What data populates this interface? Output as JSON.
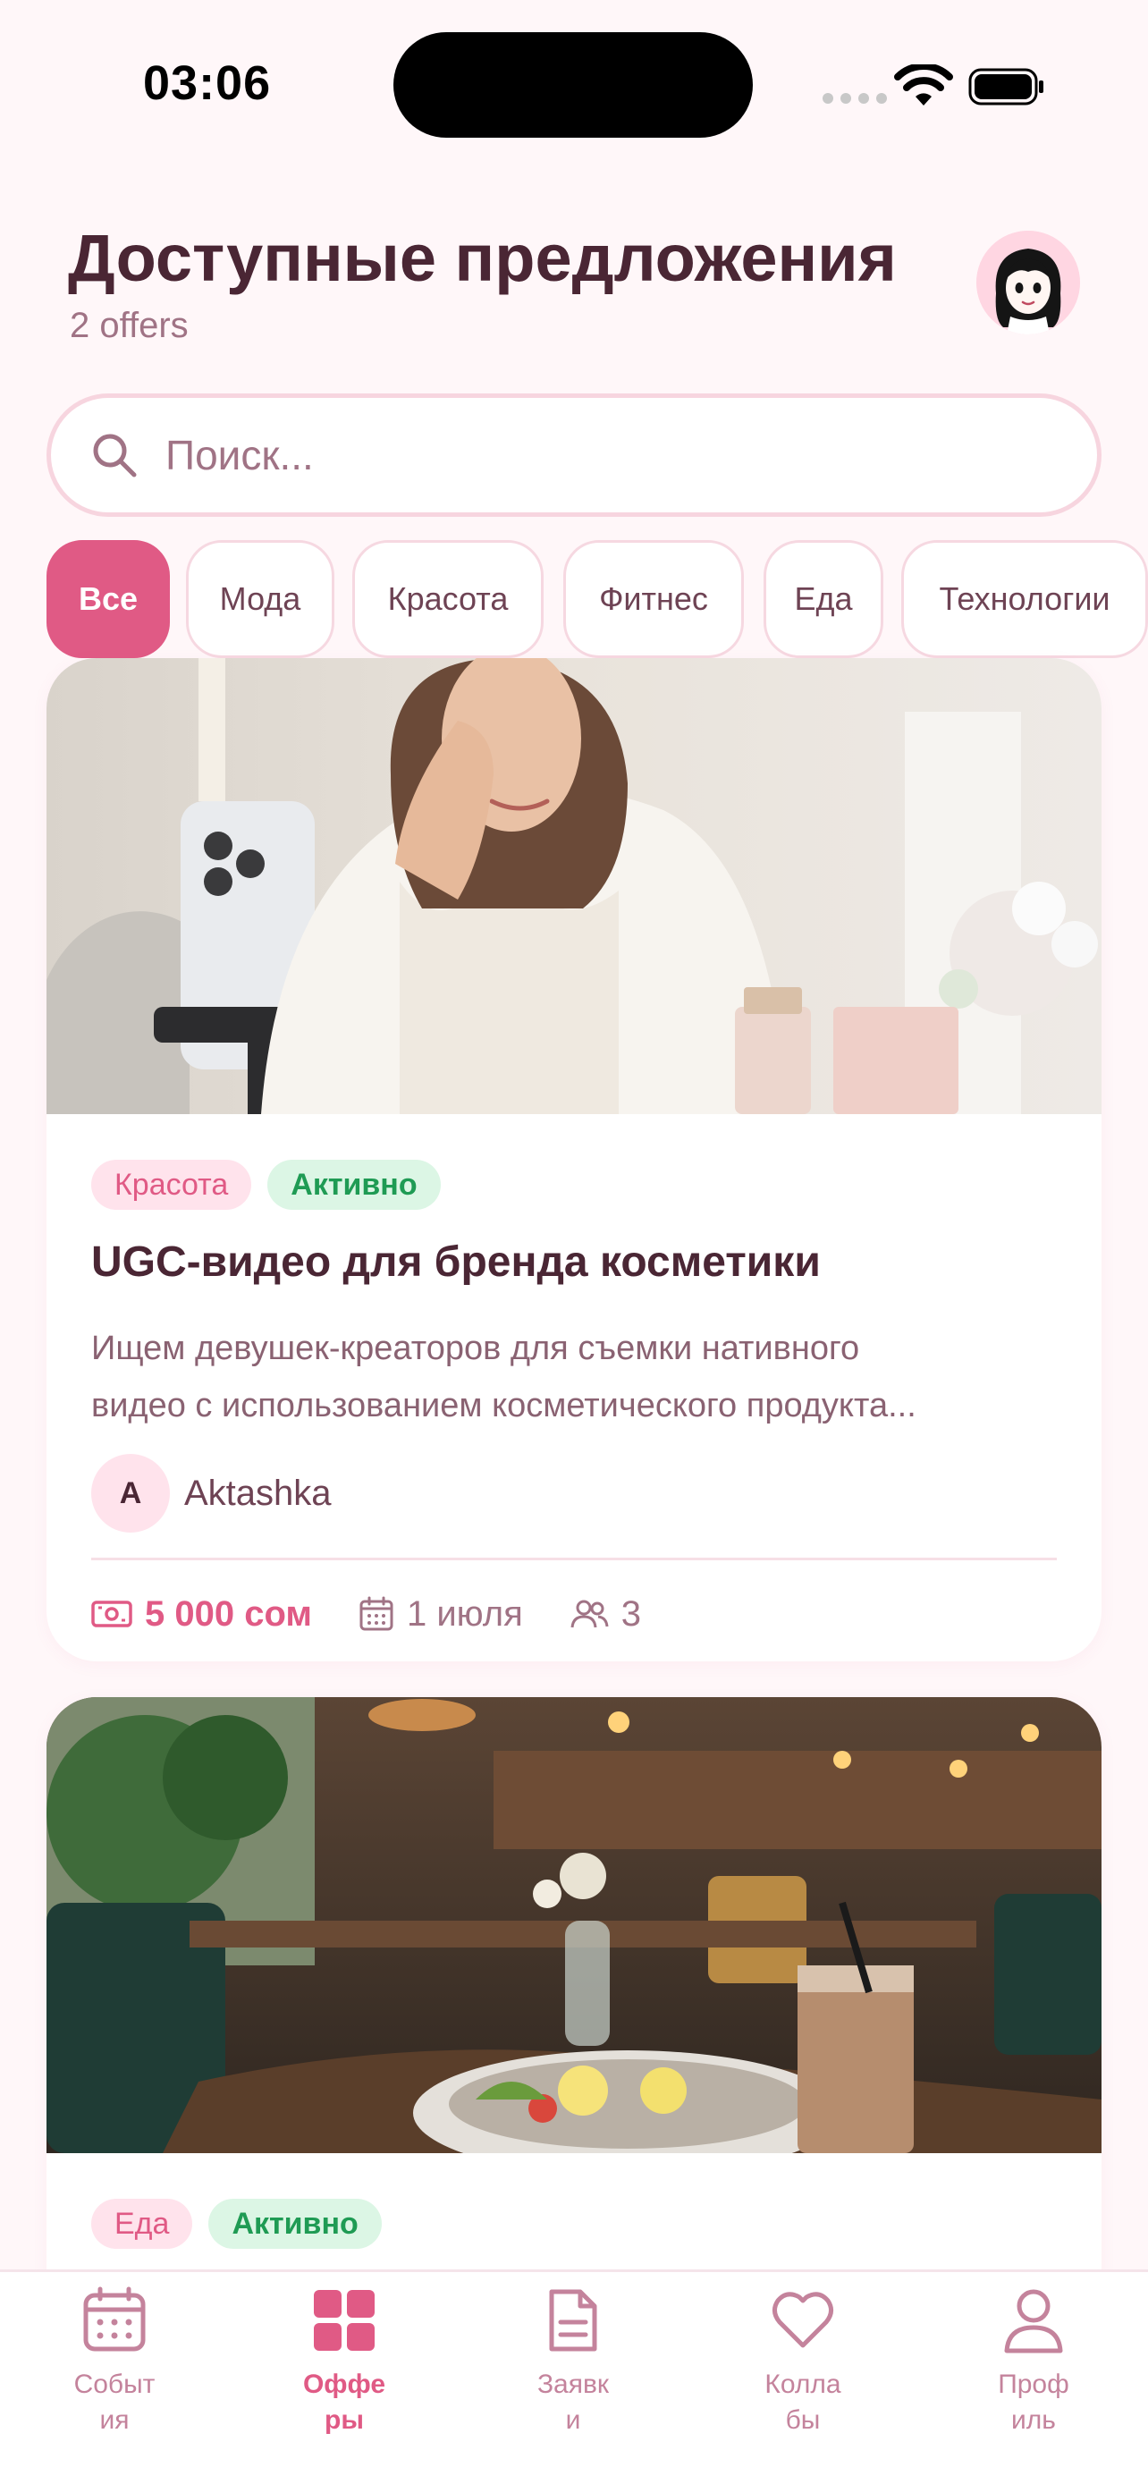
{
  "status_bar": {
    "time": "03:06"
  },
  "header": {
    "title": "Доступные предложения",
    "count": "2 offers"
  },
  "search": {
    "placeholder": "Поиск..."
  },
  "categories": [
    "Все",
    "Мода",
    "Красота",
    "Фитнес",
    "Еда",
    "Технологии"
  ],
  "active_category": "Все",
  "offers": [
    {
      "category": "Красота",
      "status": "Активно",
      "title": "UGC-видео для бренда косметики",
      "description_line1": "Ищем девушек-креаторов для съемки нативного",
      "description_line2": "видео с использованием косметического продукта...",
      "author_initial": "A",
      "author_name": "Aktashka",
      "price": "5 000 сом",
      "date": "1 июля",
      "participants": "3"
    },
    {
      "category": "Еда",
      "status": "Активно"
    }
  ],
  "nav": {
    "events": "Событ ия",
    "offers": "Оффе ры",
    "applications": "Заявк и",
    "collabs": "Колла бы",
    "profile": "Проф иль"
  },
  "colors": {
    "accent": "#e05a85",
    "background": "#fff7f9",
    "title": "#4a2634",
    "muted": "#a07385",
    "status_green": "#1f9b54"
  }
}
